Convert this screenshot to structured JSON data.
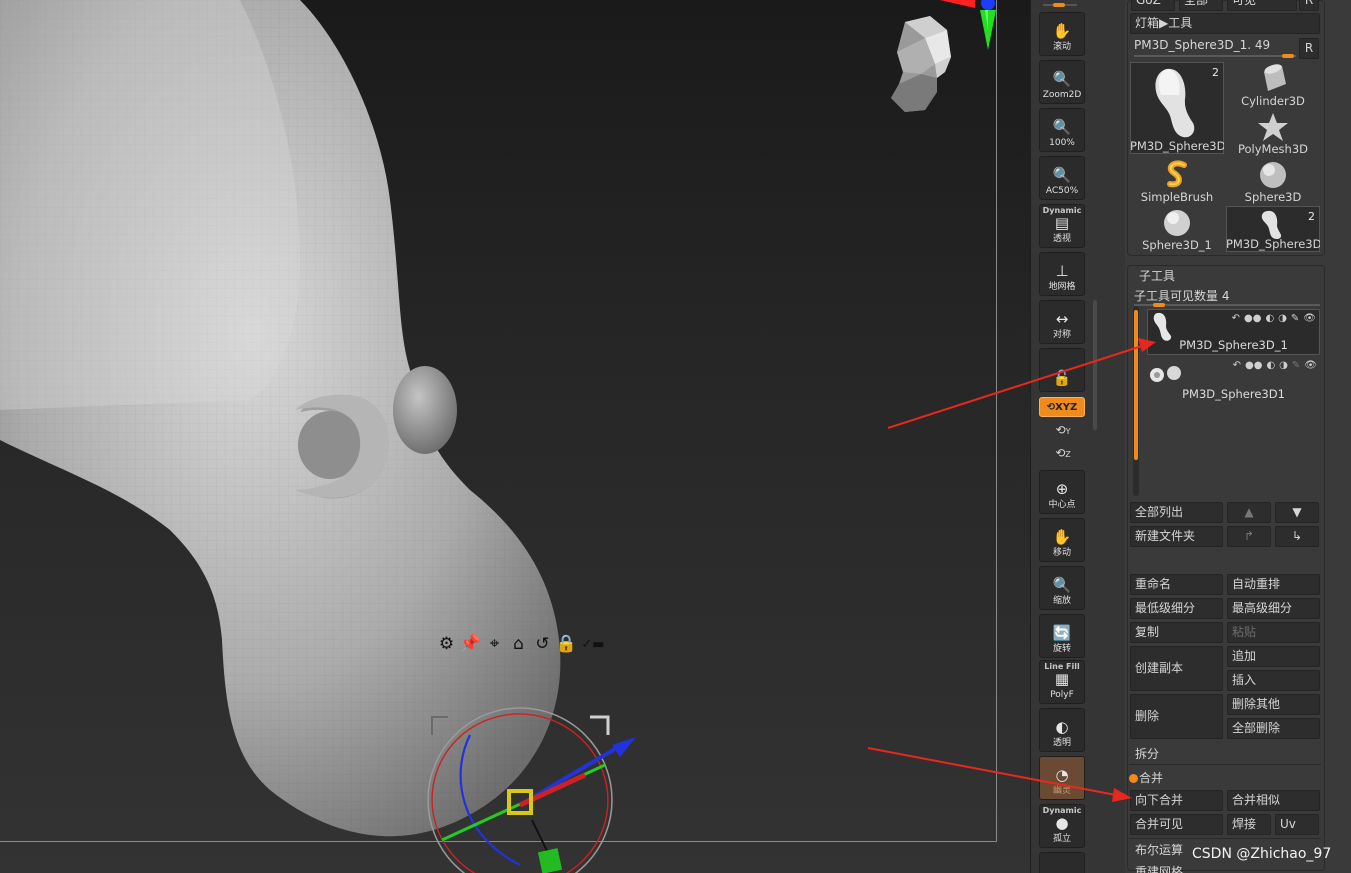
{
  "shelf": {
    "scroll_label": "滚动",
    "zoom2d_label": "Zoom2D",
    "actual_label": "100%",
    "half_label": "AC50%",
    "persp_tag": "Dynamic",
    "persp_label": "透视",
    "floor_label": "地网格",
    "sym_label": "对称",
    "xyz_label": "XYZ",
    "y_label": "Y",
    "z_label": "Z",
    "center_label": "中心点",
    "move_label": "移动",
    "scale_label": "缩放",
    "rotate_label": "旋转",
    "linefill_tag": "Line Fill",
    "polyf_label": "PolyF",
    "transp_label": "透明",
    "ghost_label": "幽灵",
    "solo_tag": "Dynamic",
    "solo_label": "孤立"
  },
  "palette": {
    "top_row": [
      "GoZ",
      "全部",
      "可见",
      "R"
    ],
    "lightbox_label": "灯箱▶工具",
    "current_tool": "PM3D_Sphere3D_1. 49",
    "r_label": "R",
    "tools": [
      {
        "name": "PM3D_Sphere3D",
        "count": "2",
        "icon": "sphere-bone-icon"
      },
      {
        "name": "Cylinder3D",
        "count": "",
        "icon": "cylinder-icon"
      },
      {
        "name": "PolyMesh3D",
        "count": "",
        "icon": "star-icon"
      },
      {
        "name": "SimpleBrush",
        "count": "",
        "icon": "brush-s-icon"
      },
      {
        "name": "Sphere3D",
        "count": "",
        "icon": "sphere-icon"
      },
      {
        "name": "Sphere3D_1",
        "count": "",
        "icon": "sphere-icon"
      },
      {
        "name": "PM3D_Sphere3D",
        "count": "2",
        "icon": "sphere-bone-icon"
      }
    ],
    "subtool": {
      "title": "子工具",
      "visible_count": "子工具可见数量 4",
      "items": [
        {
          "name": "PM3D_Sphere3D_1",
          "selected": true
        },
        {
          "name": "PM3D_Sphere3D1",
          "selected": false
        }
      ],
      "list_all": "全部列出",
      "new_folder": "新建文件夹",
      "rename": "重命名",
      "auto_reorder": "自动重排",
      "lowest_res": "最低级细分",
      "highest_res": "最高级细分",
      "copy": "复制",
      "paste": "粘贴",
      "duplicate": "创建副本",
      "append": "追加",
      "insert": "插入",
      "delete": "删除",
      "delete_other": "删除其他",
      "delete_all": "全部删除",
      "split": "拆分",
      "merge": "合并",
      "merge_down": "向下合并",
      "merge_similar": "合并相似",
      "merge_visible": "合并可见",
      "weld": "焊接",
      "uv": "Uv",
      "boolean": "布尔运算",
      "remesh": "重建网格"
    }
  },
  "watermark": "CSDN @Zhichao_97",
  "colors": {
    "accent": "#f08a1a",
    "annotation_arrow": "#e8281e"
  }
}
